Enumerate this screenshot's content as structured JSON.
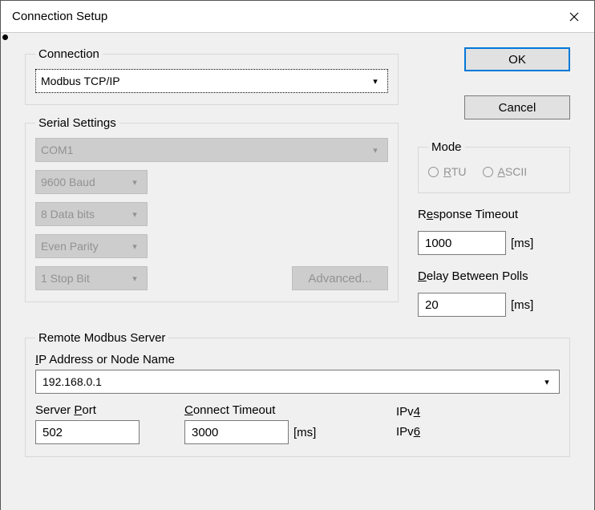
{
  "window": {
    "title": "Connection Setup"
  },
  "buttons": {
    "ok": "OK",
    "cancel": "Cancel",
    "advanced": "Advanced..."
  },
  "connection": {
    "legend": "Connection",
    "selected": "Modbus TCP/IP"
  },
  "serial": {
    "legend": "Serial Settings",
    "port": "COM1",
    "baud": "9600 Baud",
    "databits": "8 Data bits",
    "parity": "Even Parity",
    "stopbit": "1 Stop Bit"
  },
  "mode": {
    "legend": "Mode",
    "rtu_prefix": "R",
    "rtu_rest": "TU",
    "ascii_prefix": "A",
    "ascii_rest": "SCII"
  },
  "response_timeout": {
    "label_pre": "R",
    "label_mid": "e",
    "label_post": "sponse Timeout",
    "value": "1000",
    "unit": "[ms]"
  },
  "delay": {
    "label_pre": "",
    "label_mid": "D",
    "label_post": "elay Between Polls",
    "value": "20",
    "unit": "[ms]"
  },
  "remote": {
    "legend": "Remote Modbus Server",
    "ip_label_pre": "",
    "ip_label_mid": "I",
    "ip_label_post": "P Address or Node Name",
    "ip_value": "192.168.0.1",
    "port_label_pre": "Server ",
    "port_label_mid": "P",
    "port_label_post": "ort",
    "port_value": "502",
    "connect_label_pre": "",
    "connect_label_mid": "C",
    "connect_label_post": "onnect Timeout",
    "connect_value": "3000",
    "connect_unit": "[ms]",
    "ipv4_pre": "IPv",
    "ipv4_mid": "4",
    "ipv6_pre": "IPv",
    "ipv6_mid": "6"
  }
}
